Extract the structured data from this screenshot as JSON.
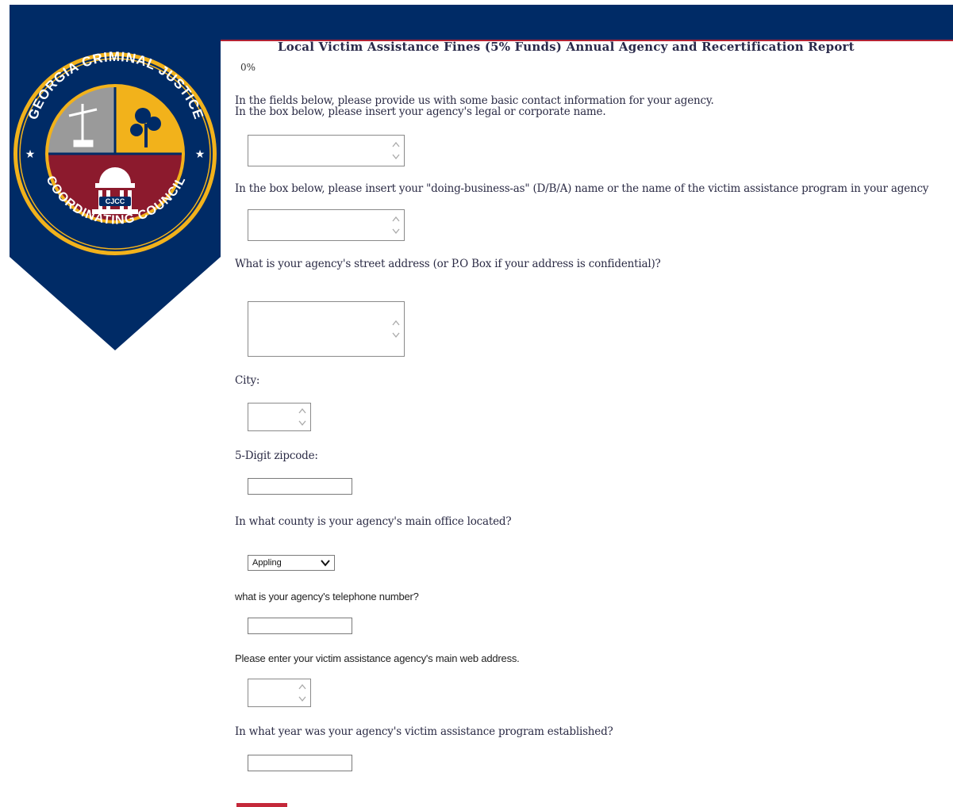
{
  "colors": {
    "navy": "#002b66",
    "gold": "#f2b21b",
    "maroon": "#8c1a2d",
    "red": "#c4283a"
  },
  "logo": {
    "top_text": "GEORGIA CRIMINAL JUSTICE",
    "bottom_text": "COORDINATING COUNCIL",
    "badge_text": "CJCC"
  },
  "survey": {
    "title": "Local Victim Assistance Fines (5% Funds) Annual Agency and Recertification Report",
    "progress": "0%",
    "progress_value": 0,
    "intro_line1": "In the fields below, please provide us with some basic contact information for your agency.",
    "intro_line2": "In the box below, please insert your agency's legal or corporate name.",
    "q_dba": "In the box below, please insert your \"doing-business-as\" (D/B/A) name or the name of the victim assistance program in your agency",
    "q_address": "What is your agency's street address (or P.O Box if your address is confidential)?",
    "q_city": "City:",
    "q_zip": "5-Digit zipcode:",
    "q_county": "In what county is your agency's main office located?",
    "county_selected": "Appling",
    "q_phone": "what is your agency's telephone number?",
    "q_web": "Please enter your victim assistance agency's main web address.",
    "q_year": "In what year was your agency's victim assistance program established?"
  },
  "fields": {
    "legal_name": "",
    "dba_name": "",
    "street_address": "",
    "city": "",
    "zipcode": "",
    "phone": "",
    "web": "",
    "year": ""
  }
}
